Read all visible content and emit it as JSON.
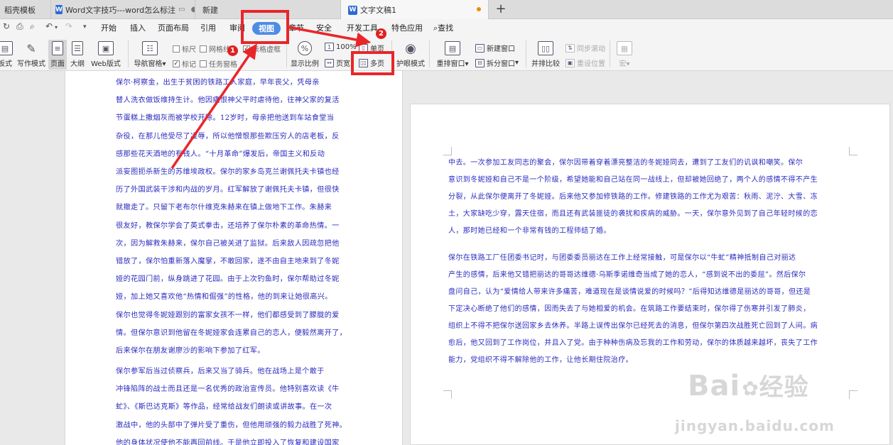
{
  "tabs": [
    {
      "label": "稻壳模板"
    },
    {
      "label": "Word文字技巧---word怎么标注",
      "close": "●"
    },
    {
      "label": "新建"
    },
    {
      "label": "文字文稿1"
    }
  ],
  "new_tab": "+",
  "menu": {
    "items": [
      "开始",
      "插入",
      "页面布局",
      "引用",
      "审阅",
      "视图",
      "章节",
      "安全",
      "开发工具",
      "特色应用"
    ],
    "search": "查找"
  },
  "ribbon": {
    "views": [
      "板式",
      "写作模式",
      "页面",
      "大纲",
      "Web版式"
    ],
    "nav": "导航窗格",
    "checks": {
      "ruler": "标尺",
      "grid": "网格线",
      "table_grid": "表格虚框",
      "mark": "标记",
      "task": "任务窗格"
    },
    "zoom": {
      "ratio": "显示比例",
      "percent": "100%",
      "page_width": "页宽",
      "single": "单页",
      "multi": "多页"
    },
    "eye": "护眼模式",
    "window": {
      "rearrange": "重排窗口",
      "new_window": "新建窗口",
      "split": "拆分窗口",
      "side_by_side": "并排比较",
      "sync_scroll": "同步滚动",
      "reset_pos": "重设位置",
      "macro": "宏"
    }
  },
  "annotations": {
    "badge1": "1",
    "badge2": "2"
  },
  "document": {
    "page1": [
      "保尔·柯察金，出生于贫困的铁路工人家庭，早年丧父，凭母亲\n替人洗衣做饭维持生计。他因痛恨神父平时虐待他，往神父家的复活\n节蛋糕上撒烟灰而被学校开除。12岁时，母亲把他送到车站食堂当\n杂役，在那儿他受尽了凌辱，所以他憎恨那些欺压穷人的店老板，反\n感那些花天酒地的有钱人。“十月革命”爆发后，帝国主义和反动\n派妄图扼杀新生的苏维埃政权。保尔的家乡岛克兰谢佩托夫卡镇也经\n历了外国武装干涉和内战的岁月。红军解放了谢佩托夫卡镇，但很快\n就撤走了。只留下老布尔什维克朱赫来在镇上做地下工作。朱赫来\n很友好，教保尔学会了英式拳击，还培养了保尔朴素的革命热情。一\n次，因为解救朱赫来，保尔自己被关进了监狱。后来敌人因疏忽把他\n错放了，保尔怕重新落入魔掌，不敢回家，遂不由自主地来到了冬妮\n娅的花园门前，纵身跳进了花园。由于上次钓鱼时，保尔帮助过冬妮\n娅，加上她又喜欢他“热情和倔强”的性格，他的到来让她很高兴。\n保尔也觉得冬妮娅跟别的富家女孩不一样，他们都感受到了朦胧的爱\n情。但保尔意识到他留在冬妮娅家会连累自己的恋人，便毅然离开了，\n后来保尔在朋友谢廖沙的影响下参加了红军。",
      "保尔参军后当过侦察兵，后来又当了骑兵。他在战场上是个敢于\n冲锋陷阵的战士而且还是一名优秀的政治宣传员。他特别喜欢读《牛\n虻》、《斯巴达克斯》等作品，经常给战友们朗读或讲故事。在一次\n激战中，他的头部中了弹片受了重伤，但他用顽强的毅力战胜了死神。\n他的身体状况使他不能再回前线。于是他立即投入了恢复和建设国家"
    ],
    "page2": [
      "中去。一次参加工友同志的聚会，保尔因带着穿着漂亮整洁的冬妮娅同去，遭到了工友们的讥讽和嘲笑。保尔\n意识到冬妮娅和自己不是一个阶级，希望她能和自己站在同一战线上，但却被她回绝了，两个人的感情不得不产生\n分裂，从此保尔便离开了冬妮娅。后来他又参加修铁路的工作。修建铁路的工作尤为艰苦：秋雨、泥泞、大雪、冻\n土，大家缺吃少穿，露天住宿，而且还有武装匪徒的袭扰和疾病的威胁。一天，保尔意外见到了自己年轻时候的恋\n人，那时她已经和一个非常有钱的工程师结了婚。",
      "保尔在铁路工厂任团委书记时，与团委委员丽达在工作上经常接触，可是保尔以“牛虻”精神抵制自己对丽达\n产生的感情，后来他又错把丽达的哥哥达维德·乌斯季诺维奇当成了她的恋人，“感到说不出的委屈”。然后保尔\n盘问自己，认为“爱情给人带来许多痛苦，难道现在是谈情说爱的时候吗？”后得知达维德是丽达的哥哥，但还是\n下定决心断绝了他们的感情，因而失去了与她相爱的机会。在筑路工作要结束时，保尔得了伤寒并引发了肺炎，\n组织上不得不把保尔送回家乡去休养。半路上误传出保尔已经死去的消息，但保尔第四次战胜死亡回到了人间。病\n愈后，他又回到了工作岗位，并且入了党。由于种种伤病及忘我的工作和劳动，保尔的体质越来越坏，丧失了工作\n能力，党组织不得不解除他的工作，让他长期住院治疗。"
    ]
  },
  "watermark": {
    "brand": "Bai",
    "brand2": "经验",
    "url": "jingyan.baidu.com"
  }
}
